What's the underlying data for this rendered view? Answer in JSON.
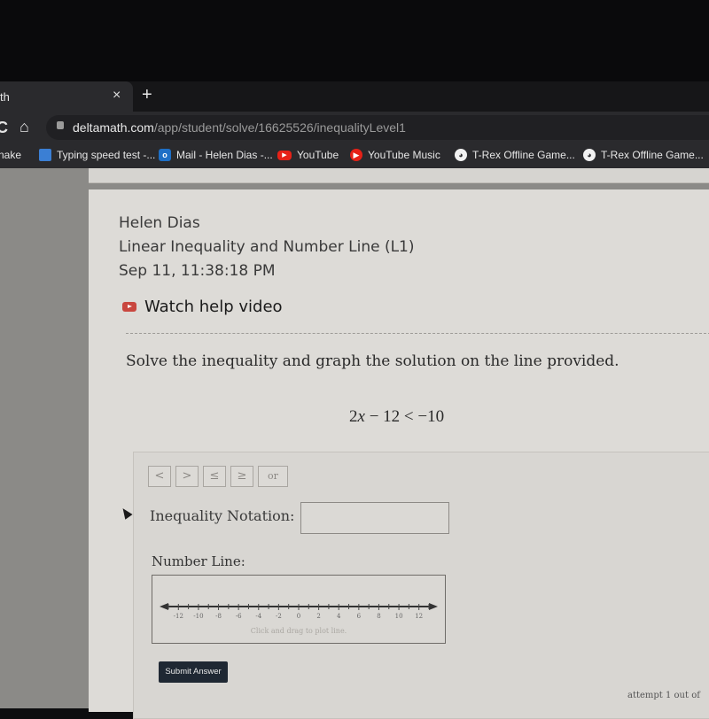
{
  "browser": {
    "tab_title": "th",
    "close_icon": "×",
    "newtab_icon": "+",
    "reload_icon": "C",
    "home_icon": "⌂",
    "url_host": "deltamath.com",
    "url_path": "/app/student/solve/16625526/inequalityLevel1",
    "bookmarks": [
      {
        "label": "nake",
        "icon": ""
      },
      {
        "label": "Typing speed test -...",
        "icon": "typing-icon"
      },
      {
        "label": "Mail - Helen Dias -...",
        "icon": "outlook-icon"
      },
      {
        "label": "YouTube",
        "icon": "youtube-icon"
      },
      {
        "label": "YouTube Music",
        "icon": "youtube-music-icon"
      },
      {
        "label": "T-Rex Offline Game...",
        "icon": "globe-icon"
      },
      {
        "label": "T-Rex Offline Game...",
        "icon": "globe-icon"
      }
    ]
  },
  "header": {
    "student_name": "Helen Dias",
    "assignment": "Linear Inequality and Number Line (L1)",
    "timestamp": "Sep 11, 11:38:18 PM",
    "help_link": "Watch help video"
  },
  "problem": {
    "prompt": "Solve the inequality and graph the solution on the line provided.",
    "eq_coef": "2",
    "eq_var": "x",
    "eq_rest": " − 12 < −10"
  },
  "answer": {
    "symbol_buttons": [
      "<",
      ">",
      "≤",
      "≥",
      "or"
    ],
    "inequality_label": "Inequality Notation:",
    "inequality_value": "",
    "number_line_label": "Number Line:",
    "number_line_hint": "Click and drag to plot line.",
    "number_line_min": -13,
    "number_line_max": 13,
    "number_line_labels": [
      -12,
      -10,
      -8,
      -6,
      -4,
      -2,
      0,
      2,
      4,
      6,
      8,
      10,
      12
    ],
    "submit_label": "Submit Answer"
  },
  "footer": {
    "attempt_text": "attempt 1 out of"
  }
}
